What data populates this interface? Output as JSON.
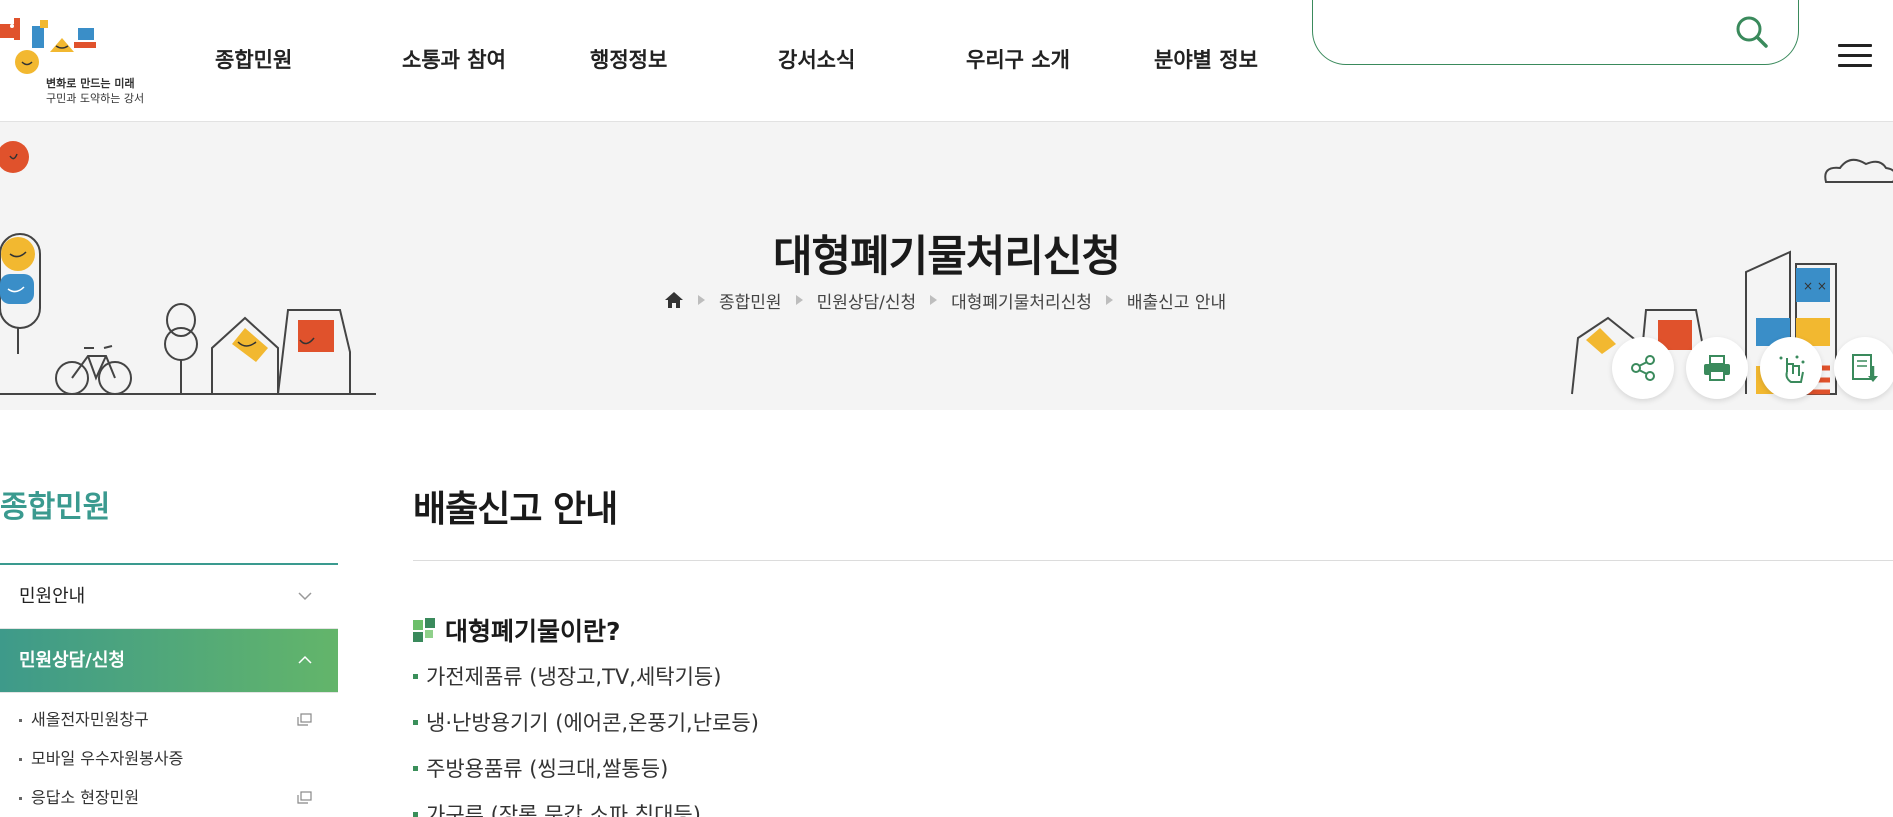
{
  "header": {
    "logo": {
      "line1": "변화로 만드는 미래",
      "line2": "구민과 도약하는 강서"
    },
    "nav": [
      {
        "label": "종합민원"
      },
      {
        "label": "소통과 참여"
      },
      {
        "label": "행정정보"
      },
      {
        "label": "강서소식"
      },
      {
        "label": "우리구 소개"
      },
      {
        "label": "분야별 정보"
      }
    ],
    "search": {
      "value": "",
      "placeholder": "",
      "icon": "search-icon"
    },
    "menu_icon": "hamburger-icon"
  },
  "visual": {
    "page_title": "대형폐기물처리신청",
    "breadcrumb": [
      "종합민원",
      "민원상담/신청",
      "대형폐기물처리신청",
      "배출신고 안내"
    ],
    "home_icon": "home-icon",
    "tools": [
      "share-icon",
      "print-icon",
      "accessibility-icon",
      "download-icon"
    ]
  },
  "sidebar": {
    "title": "종합민원",
    "items": [
      {
        "label": "민원안내",
        "state": "collapsed"
      },
      {
        "label": "민원상담/신청",
        "state": "expanded"
      }
    ],
    "sub_items": [
      {
        "label": "새올전자민원창구",
        "external": true
      },
      {
        "label": "모바일 우수자원봉사증",
        "external": false
      },
      {
        "label": "응답소 현장민원",
        "external": true
      }
    ]
  },
  "content": {
    "title": "배출신고 안내",
    "section_title": "대형폐기물이란?",
    "bullets": [
      "가전제품류 (냉장고,TV,세탁기등)",
      "냉·난방용기기 (에어콘,온풍기,난로등)",
      "주방용품류 (씽크대,쌀통등)",
      "가구류 (장롱,문갑,소파,침대등)"
    ]
  },
  "colors": {
    "accent_green": "#3a8a5c",
    "sidebar_title": "#3a9a8f",
    "active_gradient_start": "#3e9a8a",
    "active_gradient_end": "#63b56a"
  }
}
